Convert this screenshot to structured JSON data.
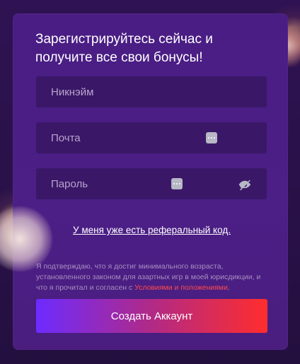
{
  "form": {
    "title": "Зарегистрируйтесь сейчас и получите все свои бонусы!",
    "fields": [
      {
        "placeholder": "Никнэйм",
        "value": ""
      },
      {
        "placeholder": "Почта",
        "value": ""
      },
      {
        "placeholder": "Пароль",
        "value": ""
      }
    ],
    "icons": {
      "password_manager": "password-manager-icon",
      "visibility": "eye-off-icon"
    },
    "referral_link": "У меня уже есть реферальный код.",
    "terms": {
      "prefix": "Я подтверждаю, что я достиг минимального возраста, установленного законом для азартных игр в моей юрисдикции, и что я прочитал и согласен с ",
      "link": "Условиями и положениями",
      "suffix": "."
    },
    "submit_label": "Создать Аккаунт"
  },
  "colors": {
    "background": "#2a0f4a",
    "card": "#4b1f86",
    "input_bg": "#3a1767",
    "accent_start": "#6d2bff",
    "accent_end": "#ff2d2d",
    "terms_link": "#ff4b4b"
  }
}
